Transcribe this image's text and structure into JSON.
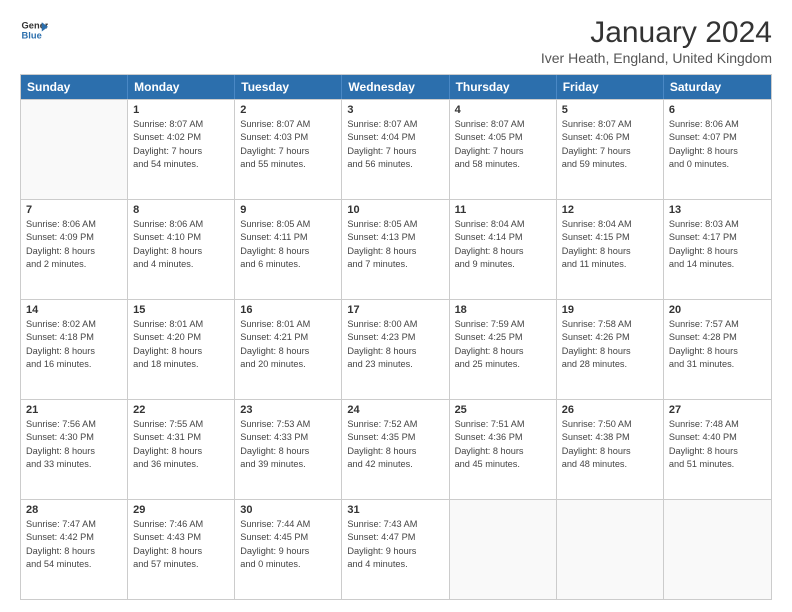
{
  "logo": {
    "line1": "General",
    "line2": "Blue"
  },
  "title": "January 2024",
  "location": "Iver Heath, England, United Kingdom",
  "weekdays": [
    "Sunday",
    "Monday",
    "Tuesday",
    "Wednesday",
    "Thursday",
    "Friday",
    "Saturday"
  ],
  "weeks": [
    [
      {
        "day": "",
        "lines": []
      },
      {
        "day": "1",
        "lines": [
          "Sunrise: 8:07 AM",
          "Sunset: 4:02 PM",
          "Daylight: 7 hours",
          "and 54 minutes."
        ]
      },
      {
        "day": "2",
        "lines": [
          "Sunrise: 8:07 AM",
          "Sunset: 4:03 PM",
          "Daylight: 7 hours",
          "and 55 minutes."
        ]
      },
      {
        "day": "3",
        "lines": [
          "Sunrise: 8:07 AM",
          "Sunset: 4:04 PM",
          "Daylight: 7 hours",
          "and 56 minutes."
        ]
      },
      {
        "day": "4",
        "lines": [
          "Sunrise: 8:07 AM",
          "Sunset: 4:05 PM",
          "Daylight: 7 hours",
          "and 58 minutes."
        ]
      },
      {
        "day": "5",
        "lines": [
          "Sunrise: 8:07 AM",
          "Sunset: 4:06 PM",
          "Daylight: 7 hours",
          "and 59 minutes."
        ]
      },
      {
        "day": "6",
        "lines": [
          "Sunrise: 8:06 AM",
          "Sunset: 4:07 PM",
          "Daylight: 8 hours",
          "and 0 minutes."
        ]
      }
    ],
    [
      {
        "day": "7",
        "lines": [
          "Sunrise: 8:06 AM",
          "Sunset: 4:09 PM",
          "Daylight: 8 hours",
          "and 2 minutes."
        ]
      },
      {
        "day": "8",
        "lines": [
          "Sunrise: 8:06 AM",
          "Sunset: 4:10 PM",
          "Daylight: 8 hours",
          "and 4 minutes."
        ]
      },
      {
        "day": "9",
        "lines": [
          "Sunrise: 8:05 AM",
          "Sunset: 4:11 PM",
          "Daylight: 8 hours",
          "and 6 minutes."
        ]
      },
      {
        "day": "10",
        "lines": [
          "Sunrise: 8:05 AM",
          "Sunset: 4:13 PM",
          "Daylight: 8 hours",
          "and 7 minutes."
        ]
      },
      {
        "day": "11",
        "lines": [
          "Sunrise: 8:04 AM",
          "Sunset: 4:14 PM",
          "Daylight: 8 hours",
          "and 9 minutes."
        ]
      },
      {
        "day": "12",
        "lines": [
          "Sunrise: 8:04 AM",
          "Sunset: 4:15 PM",
          "Daylight: 8 hours",
          "and 11 minutes."
        ]
      },
      {
        "day": "13",
        "lines": [
          "Sunrise: 8:03 AM",
          "Sunset: 4:17 PM",
          "Daylight: 8 hours",
          "and 14 minutes."
        ]
      }
    ],
    [
      {
        "day": "14",
        "lines": [
          "Sunrise: 8:02 AM",
          "Sunset: 4:18 PM",
          "Daylight: 8 hours",
          "and 16 minutes."
        ]
      },
      {
        "day": "15",
        "lines": [
          "Sunrise: 8:01 AM",
          "Sunset: 4:20 PM",
          "Daylight: 8 hours",
          "and 18 minutes."
        ]
      },
      {
        "day": "16",
        "lines": [
          "Sunrise: 8:01 AM",
          "Sunset: 4:21 PM",
          "Daylight: 8 hours",
          "and 20 minutes."
        ]
      },
      {
        "day": "17",
        "lines": [
          "Sunrise: 8:00 AM",
          "Sunset: 4:23 PM",
          "Daylight: 8 hours",
          "and 23 minutes."
        ]
      },
      {
        "day": "18",
        "lines": [
          "Sunrise: 7:59 AM",
          "Sunset: 4:25 PM",
          "Daylight: 8 hours",
          "and 25 minutes."
        ]
      },
      {
        "day": "19",
        "lines": [
          "Sunrise: 7:58 AM",
          "Sunset: 4:26 PM",
          "Daylight: 8 hours",
          "and 28 minutes."
        ]
      },
      {
        "day": "20",
        "lines": [
          "Sunrise: 7:57 AM",
          "Sunset: 4:28 PM",
          "Daylight: 8 hours",
          "and 31 minutes."
        ]
      }
    ],
    [
      {
        "day": "21",
        "lines": [
          "Sunrise: 7:56 AM",
          "Sunset: 4:30 PM",
          "Daylight: 8 hours",
          "and 33 minutes."
        ]
      },
      {
        "day": "22",
        "lines": [
          "Sunrise: 7:55 AM",
          "Sunset: 4:31 PM",
          "Daylight: 8 hours",
          "and 36 minutes."
        ]
      },
      {
        "day": "23",
        "lines": [
          "Sunrise: 7:53 AM",
          "Sunset: 4:33 PM",
          "Daylight: 8 hours",
          "and 39 minutes."
        ]
      },
      {
        "day": "24",
        "lines": [
          "Sunrise: 7:52 AM",
          "Sunset: 4:35 PM",
          "Daylight: 8 hours",
          "and 42 minutes."
        ]
      },
      {
        "day": "25",
        "lines": [
          "Sunrise: 7:51 AM",
          "Sunset: 4:36 PM",
          "Daylight: 8 hours",
          "and 45 minutes."
        ]
      },
      {
        "day": "26",
        "lines": [
          "Sunrise: 7:50 AM",
          "Sunset: 4:38 PM",
          "Daylight: 8 hours",
          "and 48 minutes."
        ]
      },
      {
        "day": "27",
        "lines": [
          "Sunrise: 7:48 AM",
          "Sunset: 4:40 PM",
          "Daylight: 8 hours",
          "and 51 minutes."
        ]
      }
    ],
    [
      {
        "day": "28",
        "lines": [
          "Sunrise: 7:47 AM",
          "Sunset: 4:42 PM",
          "Daylight: 8 hours",
          "and 54 minutes."
        ]
      },
      {
        "day": "29",
        "lines": [
          "Sunrise: 7:46 AM",
          "Sunset: 4:43 PM",
          "Daylight: 8 hours",
          "and 57 minutes."
        ]
      },
      {
        "day": "30",
        "lines": [
          "Sunrise: 7:44 AM",
          "Sunset: 4:45 PM",
          "Daylight: 9 hours",
          "and 0 minutes."
        ]
      },
      {
        "day": "31",
        "lines": [
          "Sunrise: 7:43 AM",
          "Sunset: 4:47 PM",
          "Daylight: 9 hours",
          "and 4 minutes."
        ]
      },
      {
        "day": "",
        "lines": []
      },
      {
        "day": "",
        "lines": []
      },
      {
        "day": "",
        "lines": []
      }
    ]
  ]
}
